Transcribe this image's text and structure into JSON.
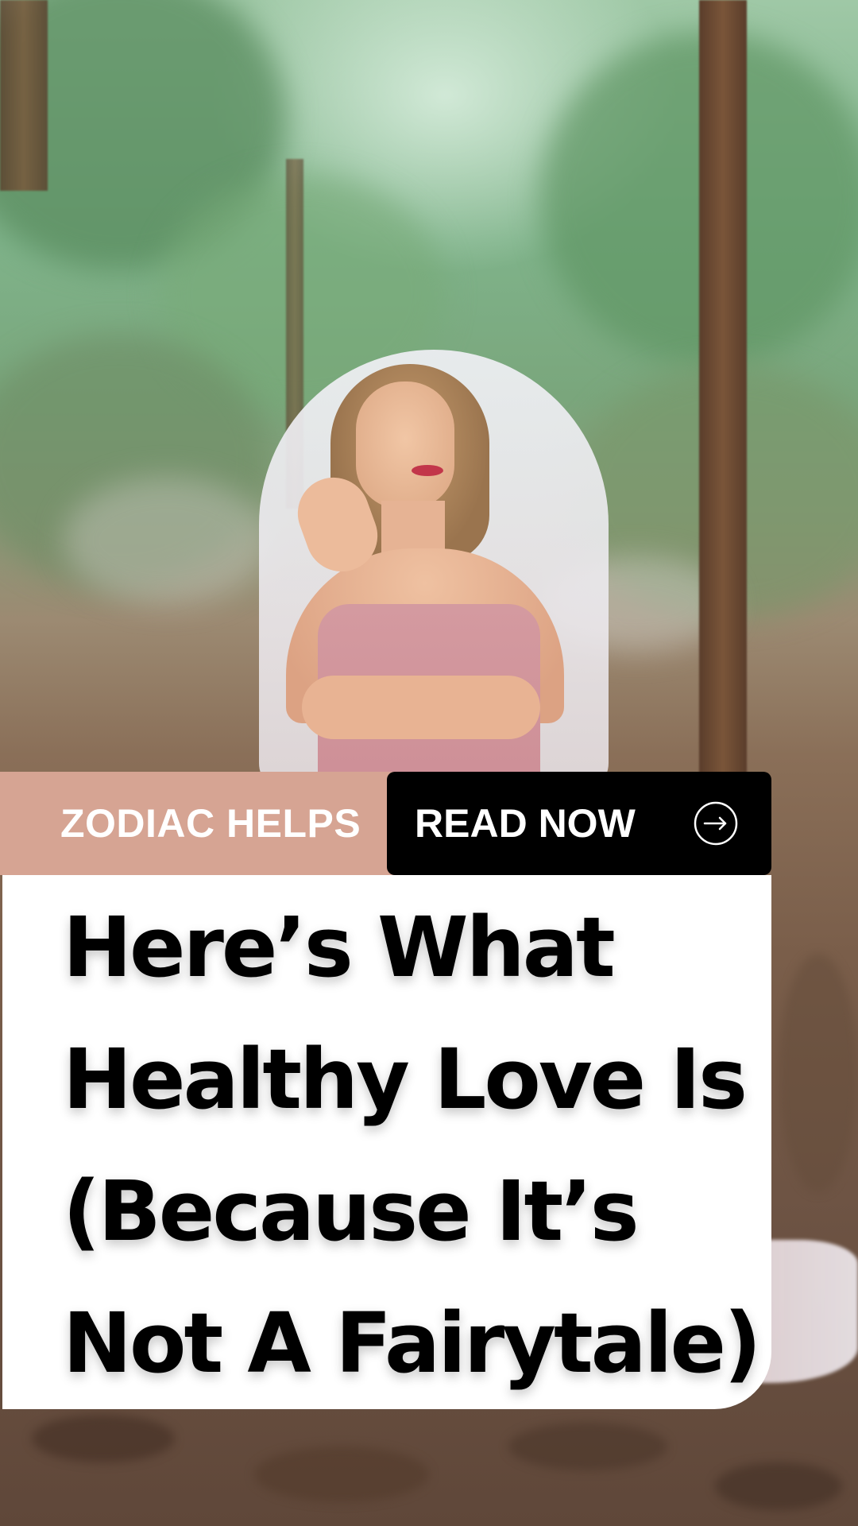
{
  "background": {
    "description_icon": "forest-portrait-photo"
  },
  "tag": {
    "label": "ZODIAC HELPS",
    "color": "#d6a493"
  },
  "cta": {
    "label": "READ NOW",
    "icon": "arrow-right-circle-icon",
    "color": "#000000"
  },
  "headline": {
    "lines": [
      "Here’s What",
      "Healthy Love Is",
      "(Because It’s",
      "Not A Fairytale)"
    ]
  }
}
